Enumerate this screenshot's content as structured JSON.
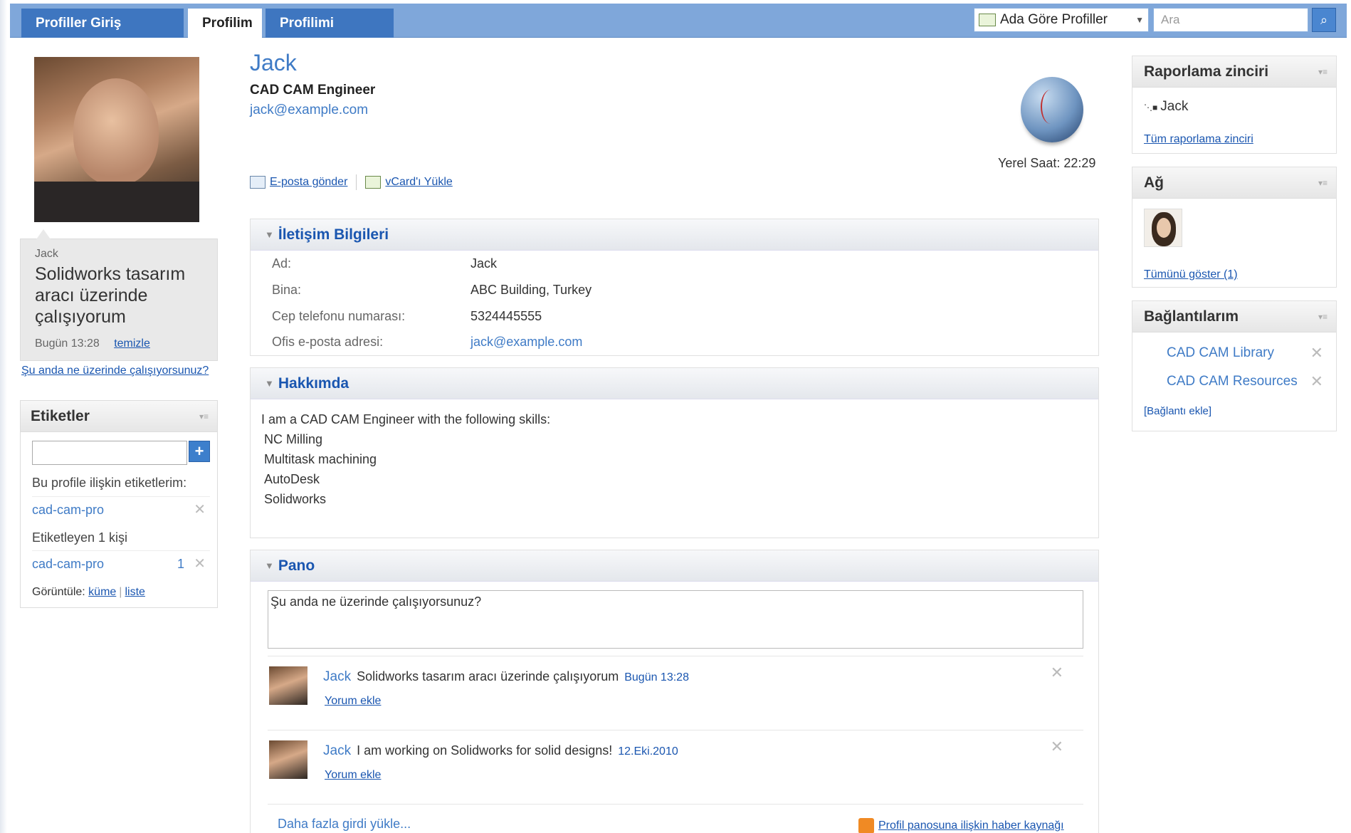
{
  "nav": {
    "tabs": [
      "Profiller Giriş Sayfası",
      "Profilim",
      "Profilimi Düzenle"
    ],
    "search_scope": "Ada Göre Profiller",
    "search_placeholder": "Ara"
  },
  "status": {
    "name": "Jack",
    "text": "Solidworks tasarım aracı üzerinde çalışıyorum",
    "time": "Bugün 13:28",
    "clear_label": "temizle",
    "ask_label": "Şu anda ne üzerinde çalışıyorsunuz?"
  },
  "tags": {
    "title": "Etiketler",
    "my_tags_label": "Bu profile ilişkin etiketlerim:",
    "my_tag": "cad-cam-pro",
    "taggers_label": "Etiketleyen 1 kişi",
    "tagger_tag": "cad-cam-pro",
    "tagger_count": "1",
    "view_label": "Görüntüle:",
    "view_cloud": "küme",
    "view_list": "liste"
  },
  "profile": {
    "name": "Jack",
    "title": "CAD CAM Engineer",
    "email": "jack@example.com",
    "local_time": "Yerel Saat: 22:29",
    "send_email": "E-posta gönder",
    "vcard": "vCard'ı Yükle"
  },
  "contact": {
    "title": "İletişim Bilgileri",
    "rows": [
      {
        "label": "Ad:",
        "value": "Jack"
      },
      {
        "label": "Bina:",
        "value": "ABC Building, Turkey"
      },
      {
        "label": "Cep telefonu numarası:",
        "value": "5324445555"
      },
      {
        "label": "Ofis e-posta adresi:",
        "value": "jack@example.com"
      }
    ]
  },
  "about": {
    "title": "Hakkımda",
    "intro": "I am a CAD CAM Engineer with the following skills:",
    "skills": [
      "NC Milling",
      "Multitask machining",
      "AutoDesk",
      "Solidworks"
    ]
  },
  "board": {
    "title": "Pano",
    "input_value": "Şu anda ne üzerinde çalışıyorsunuz?",
    "posts": [
      {
        "author": "Jack",
        "text": "Solidworks tasarım aracı üzerinde çalışıyorum",
        "time": "Bugün 13:28",
        "comment": "Yorum ekle"
      },
      {
        "author": "Jack",
        "text": "I am working on Solidworks for solid designs!",
        "time": "12.Eki.2010",
        "comment": "Yorum ekle"
      }
    ],
    "load_more": "Daha fazla girdi yükle...",
    "feed": "Profil panosuna ilişkin haber kaynağı"
  },
  "reporting": {
    "title": "Raporlama zinciri",
    "item": "Jack",
    "link": "Tüm raporlama zinciri"
  },
  "network": {
    "title": "Ağ",
    "link": "Tümünü göster (1)"
  },
  "links": {
    "title": "Bağlantılarım",
    "items": [
      "CAD CAM Library",
      "CAD CAM Resources"
    ],
    "add": "[Bağlantı ekle]"
  }
}
